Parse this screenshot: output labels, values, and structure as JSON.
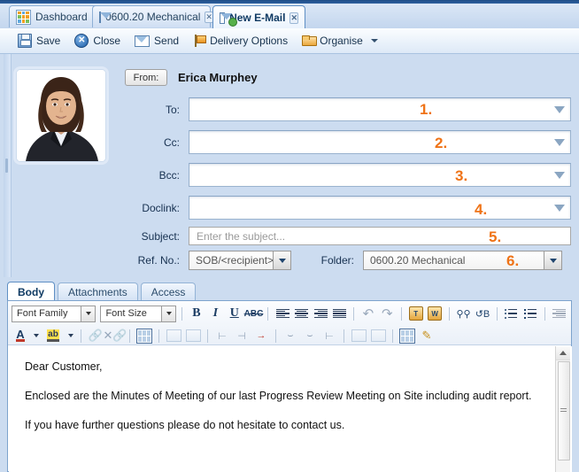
{
  "window": {
    "tabs": [
      {
        "label": "Dashboard",
        "icon": "dashboard-grid-icon",
        "active": false,
        "closable": false
      },
      {
        "label": "0600.20 Mechanical",
        "icon": "envelope-icon",
        "active": false,
        "closable": true
      },
      {
        "label": "New E-Mail",
        "icon": "envelope-new-icon",
        "active": true,
        "closable": true
      }
    ]
  },
  "toolbar": {
    "items": [
      {
        "label": "Save",
        "icon": "floppy-disk-icon",
        "dropdown": false
      },
      {
        "label": "Close",
        "icon": "close-circle-icon",
        "dropdown": false
      },
      {
        "label": "Send",
        "icon": "envelope-icon",
        "dropdown": false
      },
      {
        "label": "Delivery Options",
        "icon": "flag-icon",
        "dropdown": false
      },
      {
        "label": "Organise",
        "icon": "folder-open-icon",
        "dropdown": true
      }
    ]
  },
  "form": {
    "photo_alt": "sender-portrait-photo",
    "from_button_label": "From:",
    "from_name": "Erica Murphey",
    "fields": [
      {
        "label": "To:",
        "value": "",
        "placeholder": "",
        "annotation": "1.",
        "type": "lookup"
      },
      {
        "label": "Cc:",
        "value": "",
        "placeholder": "",
        "annotation": "2.",
        "type": "lookup"
      },
      {
        "label": "Bcc:",
        "value": "",
        "placeholder": "",
        "annotation": "3.",
        "type": "lookup"
      },
      {
        "label": "Doclink:",
        "value": "",
        "placeholder": "",
        "annotation": "4.",
        "type": "lookup"
      }
    ],
    "subject": {
      "label": "Subject:",
      "value": "",
      "placeholder": "Enter the subject...",
      "annotation": "5."
    },
    "ref_no": {
      "label": "Ref. No.:",
      "value": "SOB/<recipient>"
    },
    "folder": {
      "label": "Folder:",
      "value": "0600.20 Mechanical",
      "annotation": "6."
    }
  },
  "body_tabs": [
    {
      "label": "Body",
      "active": true
    },
    {
      "label": "Attachments",
      "active": false
    },
    {
      "label": "Access",
      "active": false
    }
  ],
  "editor": {
    "font_family_placeholder": "Font Family",
    "font_size_placeholder": "Font Size",
    "buttons_row1": [
      {
        "name": "bold-button",
        "glyph": "B"
      },
      {
        "name": "italic-button",
        "glyph": "I"
      },
      {
        "name": "underline-button",
        "glyph": "U"
      },
      {
        "name": "strikethrough-button",
        "glyph": "ABC"
      },
      {
        "name": "align-left-button",
        "glyph": ""
      },
      {
        "name": "align-center-button",
        "glyph": ""
      },
      {
        "name": "align-right-button",
        "glyph": ""
      },
      {
        "name": "align-justify-button",
        "glyph": ""
      },
      {
        "name": "undo-button",
        "glyph": "↶"
      },
      {
        "name": "redo-button",
        "glyph": "↷"
      },
      {
        "name": "paste-text-button",
        "glyph": "T"
      },
      {
        "name": "paste-word-button",
        "glyph": "W"
      },
      {
        "name": "find-button",
        "glyph": "♌"
      },
      {
        "name": "replace-button",
        "glyph": "B"
      },
      {
        "name": "bullet-list-button",
        "glyph": ""
      },
      {
        "name": "numbered-list-button",
        "glyph": ""
      },
      {
        "name": "outdent-button",
        "glyph": ""
      }
    ],
    "buttons_row2": [
      {
        "name": "text-color-button",
        "glyph": "A"
      },
      {
        "name": "text-color-dropdown",
        "glyph": ""
      },
      {
        "name": "highlight-color-button",
        "glyph": "ab"
      },
      {
        "name": "highlight-color-dropdown",
        "glyph": ""
      },
      {
        "name": "insert-link-button",
        "glyph": "∞"
      },
      {
        "name": "remove-link-button",
        "glyph": "∞"
      },
      {
        "name": "edit-source-button",
        "glyph": ""
      },
      {
        "name": "insert-table-button",
        "glyph": ""
      },
      {
        "name": "table-properties-button",
        "glyph": ""
      },
      {
        "name": "insert-row-before-button",
        "glyph": ""
      },
      {
        "name": "insert-row-after-button",
        "glyph": ""
      },
      {
        "name": "delete-row-button",
        "glyph": ""
      },
      {
        "name": "insert-column-before-button",
        "glyph": ""
      },
      {
        "name": "insert-column-after-button",
        "glyph": ""
      },
      {
        "name": "delete-column-button",
        "glyph": ""
      },
      {
        "name": "merge-cells-button",
        "glyph": ""
      },
      {
        "name": "split-cells-button",
        "glyph": ""
      },
      {
        "name": "page-properties-button",
        "glyph": ""
      },
      {
        "name": "edit-template-button",
        "glyph": ""
      }
    ]
  },
  "message": {
    "greeting": "Dear Customer,",
    "paragraph1": "Enclosed are the Minutes of Meeting of our last Progress Review Meeting on Site including audit report.",
    "paragraph2": "If you have further questions please do not hesitate to contact us."
  },
  "colors": {
    "annotation": "#ef7317",
    "tab_active_text": "#103a63",
    "chrome_blue": "#ccdcf0",
    "titlebar": "#1f4e87"
  }
}
